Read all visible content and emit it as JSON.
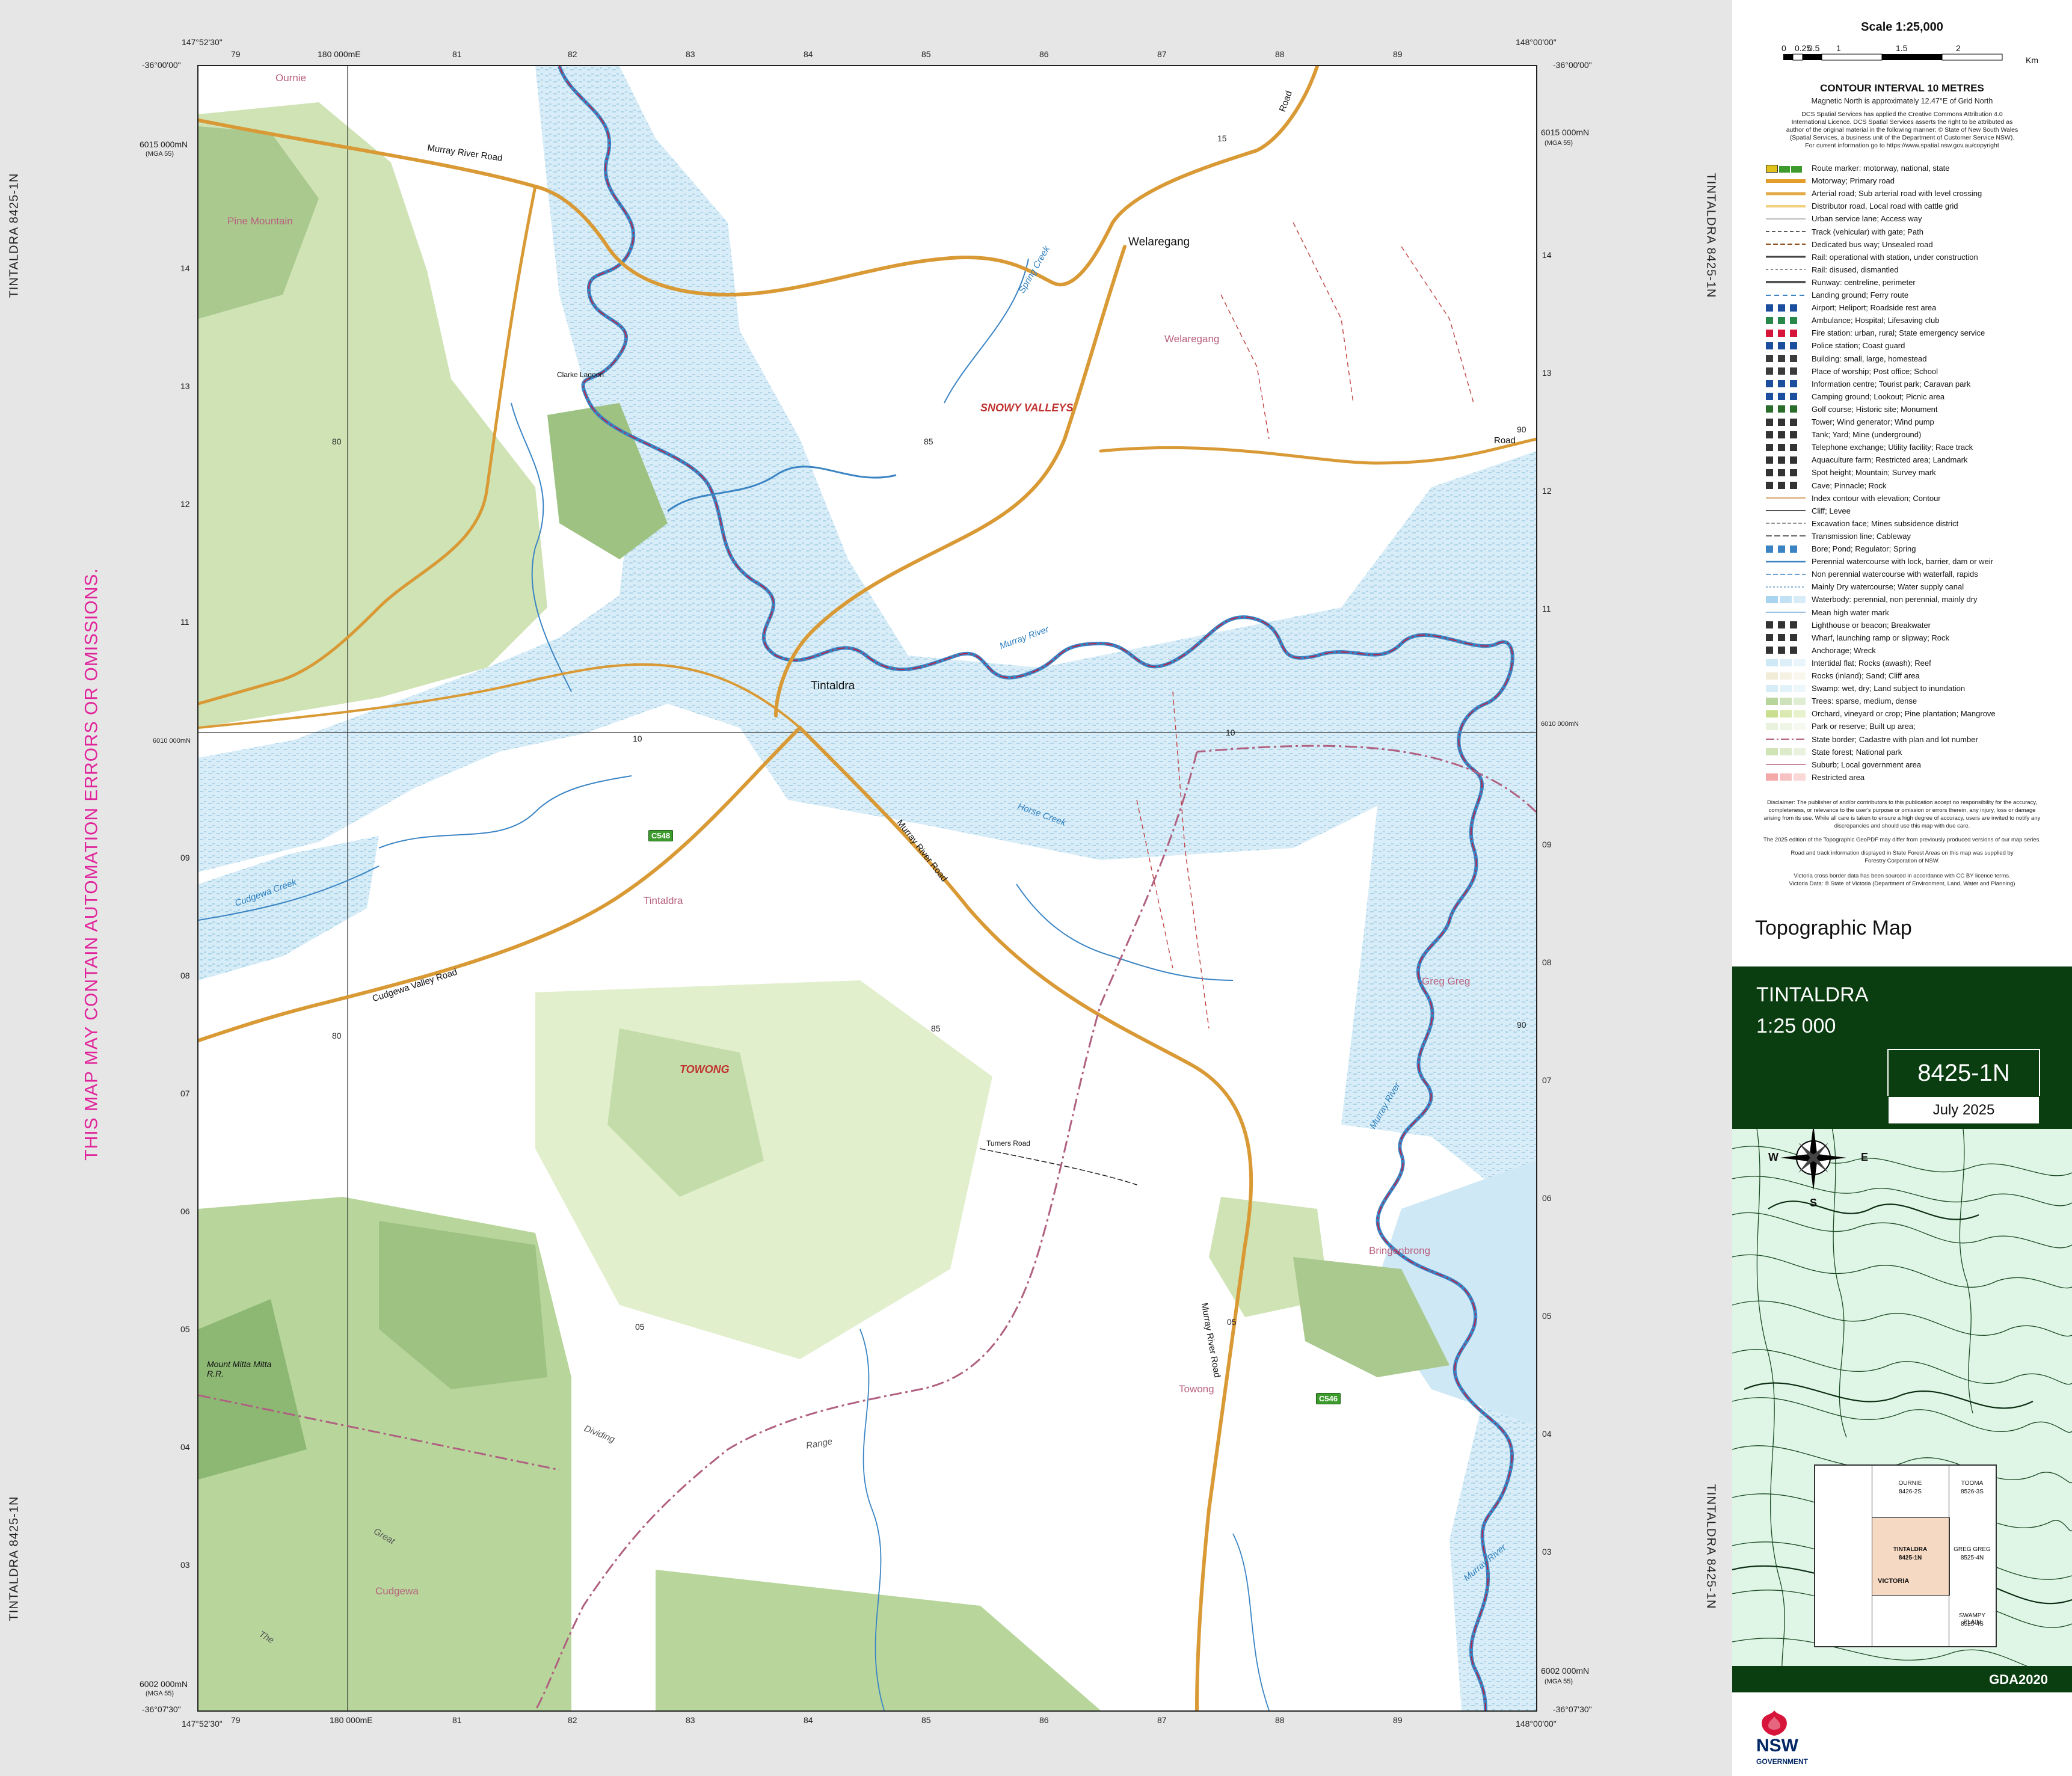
{
  "sheet": {
    "id_label": "TINTALDRA 8425-1N",
    "warning": "THIS MAP MAY CONTAIN AUTOMATION ERRORS OR OMISSIONS."
  },
  "edges": {
    "top_left_lon": "147°52'30\"",
    "top_right_lon": "148°00'00\"",
    "top_left_lat": "-36°00'00\"",
    "top_right_lat": "-36°00'00\"",
    "bottom_left_lon": "147°52'30\"",
    "bottom_right_lon": "148°00'00\"",
    "bottom_left_lat": "-36°07'30\"",
    "bottom_right_lat": "-36°07'30\"",
    "easting_top": "79",
    "easting_mark": "180 000mE",
    "northing_top": "6015 000mN",
    "northing_top_sub": "(MGA 55)",
    "northing_mid": "6010 000mN",
    "northing_bottom": "6002 000mN",
    "northing_bottom_sub": "(MGA 55)",
    "eastings": [
      "79",
      "81",
      "82",
      "83",
      "84",
      "85",
      "86",
      "87",
      "88",
      "89"
    ],
    "northings": [
      "14",
      "13",
      "12",
      "11",
      "09",
      "08",
      "07",
      "06",
      "05",
      "04",
      "03"
    ],
    "northings_right": [
      "14",
      "13",
      "12",
      "11",
      "09",
      "08",
      "07",
      "06",
      "05",
      "04",
      "03"
    ]
  },
  "places": {
    "ournie": "Ournie",
    "pine_mountain": "Pine Mountain",
    "welaregang_town": "Welaregang",
    "welaregang_locality": "Welaregang",
    "snowy_valleys": "SNOWY VALLEYS",
    "tintaldra_town": "Tintaldra",
    "tintaldra_locality": "Tintaldra",
    "towong_region": "TOWONG",
    "towong_locality": "Towong",
    "greg_greg": "Greg Greg",
    "bringenbrong": "Bringenbrong",
    "cudgewa": "Cudgewa",
    "mount_mitta": "Mount Mitta Mitta R.R.",
    "clarke_lagoon": "Clarke Lagoon",
    "great": "Great",
    "dividing": "Dividing",
    "range": "Range",
    "the": "The"
  },
  "roads": {
    "murray_river_road_n": "Murray River Road",
    "murray_river_road_c": "Murray River Road",
    "murray_river_road_s": "Murray River Road",
    "cudgewa_valley_road": "Cudgewa Valley Road",
    "road_ne": "Road",
    "road_e": "Road",
    "c548": "C548",
    "c546": "C546",
    "turners_road": "Turners Road"
  },
  "hydro": {
    "murray_river_1": "Murray River",
    "murray_river_2": "Murray River",
    "murray_river_3": "Murray River",
    "cudgewa_creek": "Cudgewa Creek",
    "spring_creek": "Spring Creek",
    "horse_creek": "Horse Creek"
  },
  "grid_labels": {
    "g80a": "80",
    "g85a": "85",
    "g90a": "90",
    "g10a": "10",
    "g10b": "10",
    "g80b": "80",
    "g85b": "85",
    "g90b": "90",
    "g05a": "05",
    "g05b": "05",
    "g15": "15"
  },
  "panel": {
    "scale_title": "Scale 1:25,000",
    "scale_ticks": [
      "0",
      "0.25",
      "0.5",
      "1",
      "1.5",
      "2"
    ],
    "scale_unit": "Km",
    "contour_interval": "CONTOUR INTERVAL 10 METRES",
    "magnetic_north": "Magnetic North is approximately 12.47°E of Grid North",
    "licence_1": "DCS Spatial Services has applied the Creative Commons Attribution 4.0",
    "licence_2": "International Licence. DCS Spatial Services asserts the right to be attributed as",
    "licence_3": "author of the original material in the following manner: © State of New South Wales",
    "licence_4": "(Spatial Services, a business unit of the Department of Customer Service NSW).",
    "licence_5": "For current information go to https://www.spatial.nsw.gov.au/copyright",
    "legend": [
      "Route marker: motorway, national, state",
      "Motorway; Primary road",
      "Arterial road; Sub arterial road with level crossing",
      "Distributor road, Local road with cattle grid",
      "Urban service lane; Access way",
      "Track (vehicular) with gate; Path",
      "Dedicated bus way; Unsealed road",
      "Rail: operational with station, under construction",
      "Rail: disused, dismantled",
      "Runway: centreline, perimeter",
      "Landing ground; Ferry route",
      "Airport; Heliport; Roadside rest area",
      "Ambulance; Hospital; Lifesaving club",
      "Fire station: urban, rural; State emergency service",
      "Police station; Coast guard",
      "Building: small, large, homestead",
      "Place of worship; Post office; School",
      "Information centre; Tourist park; Caravan park",
      "Camping ground; Lookout; Picnic area",
      "Golf course; Historic site; Monument",
      "Tower; Wind generator; Wind pump",
      "Tank; Yard; Mine (underground)",
      "Telephone exchange; Utility facility; Race track",
      "Aquaculture farm; Restricted area; Landmark",
      "Spot height; Mountain; Survey mark",
      "Cave; Pinnacle; Rock",
      "Index contour with elevation; Contour",
      "Cliff; Levee",
      "Excavation face; Mines subsidence district",
      "Transmission line; Cableway",
      "Bore; Pond; Regulator; Spring",
      "Perennial watercourse with lock, barrier, dam or weir",
      "Non perennial watercourse with waterfall, rapids",
      "Mainly Dry watercourse; Water supply canal",
      "Waterbody: perennial, non perennial, mainly dry",
      "Mean high water mark",
      "Lighthouse or beacon; Breakwater",
      "Wharf, launching ramp or slipway; Rock",
      "Anchorage; Wreck",
      "Intertidal flat; Rocks (awash); Reef",
      "Rocks (inland); Sand; Cliff area",
      "Swamp: wet, dry; Land subject to inundation",
      "Trees: sparse, medium, dense",
      "Orchard, vineyard or crop; Pine plantation; Mangrove",
      "Park or reserve; Built up area;",
      "State border; Cadastre with plan and lot number",
      "State forest; National park",
      "Suburb; Local government area",
      "Restricted area"
    ],
    "disclaimer_1": "Disclaimer: The publisher of and/or contributors to this publication accept no responsibility for the accuracy,",
    "disclaimer_2": "completeness, or relevance to the user's purpose or omission or errors therein, any injury, loss or damage",
    "disclaimer_3": "arising from its use. While all care is taken to ensure a high degree of accuracy, users are invited to notify any",
    "disclaimer_4": "discrepancies and should use this map with due care.",
    "edition_note": "The 2025 edition of the Topographic GeoPDF may differ from previously produced versions of our map series.",
    "forestry_1": "Road and track information displayed in State Forest Areas on this map was supplied by",
    "forestry_2": "Forestry Corporation of NSW.",
    "vic_1": "Victoria cross border data has been sourced in accordance with CC BY licence terms.",
    "vic_2": "Victoria Data: © State of Victoria (Department of Environment, Land, Water and Planning)",
    "map_type": "Topographic Map",
    "map_name": "TINTALDRA",
    "map_scale": "1:25 000",
    "sheet_number": "8425-1N",
    "date": "July 2025",
    "compass_n": "N",
    "compass_s": "S",
    "compass_e": "E",
    "compass_w": "W",
    "index_ournie": "OURNIE",
    "index_ournie_no": "8426-2S",
    "index_tooma": "TOOMA",
    "index_tooma_no": "8526-3S",
    "index_tintaldra": "TINTALDRA",
    "index_tintaldra_no": "8425-1N",
    "index_greg": "GREG GREG",
    "index_greg_no": "8525-4N",
    "index_victoria": "VICTORIA",
    "index_swampy": "SWAMPY PLAIN",
    "index_swampy_no": "8525-4S",
    "datum": "GDA2020",
    "nsw": "NSW",
    "government": "GOVERNMENT"
  }
}
